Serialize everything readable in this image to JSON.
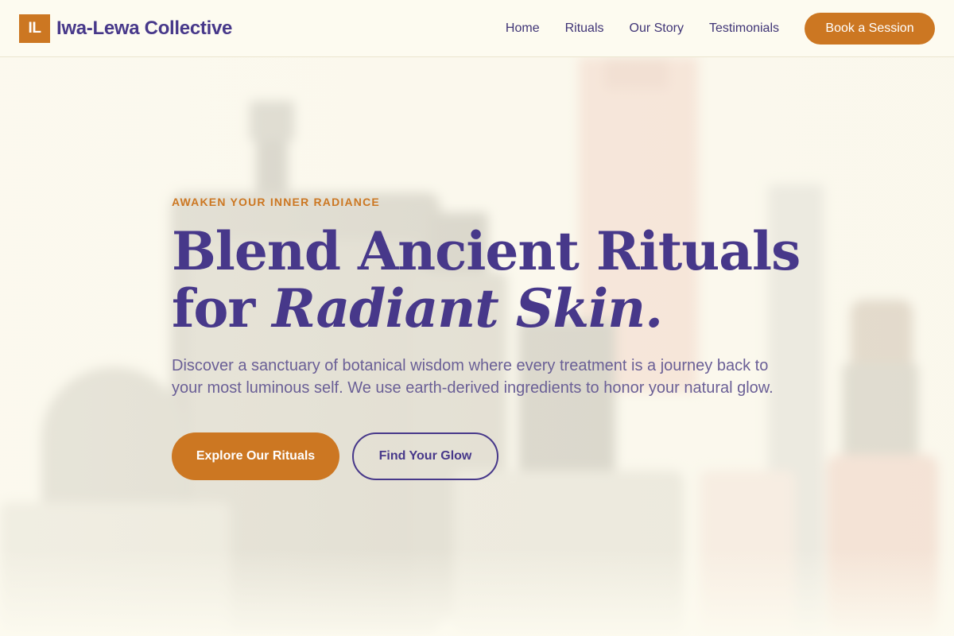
{
  "brand": {
    "initials": "IL",
    "name": "Iwa-Lewa Collective"
  },
  "nav": {
    "links": [
      "Home",
      "Rituals",
      "Our Story",
      "Testimonials"
    ],
    "cta": "Book a Session"
  },
  "hero": {
    "eyebrow": "AWAKEN YOUR INNER RADIANCE",
    "headline_line1": "Blend Ancient Rituals",
    "headline_line2_plain": "for",
    "headline_line2_italic": "Radiant Skin.",
    "lead": "Discover a sanctuary of botanical wisdom where every treatment is a journey back to your most luminous self. We use earth-derived ingredients to honor your natural glow.",
    "primary_button": "Explore Our Rituals",
    "secondary_button": "Find Your Glow",
    "background_image": "blurred-skincare-bottles-photo"
  },
  "colors": {
    "accent": "#cc7722",
    "brand_purple": "#47388a",
    "body_text": "#6a5f96",
    "background": "#fdfbf0"
  }
}
